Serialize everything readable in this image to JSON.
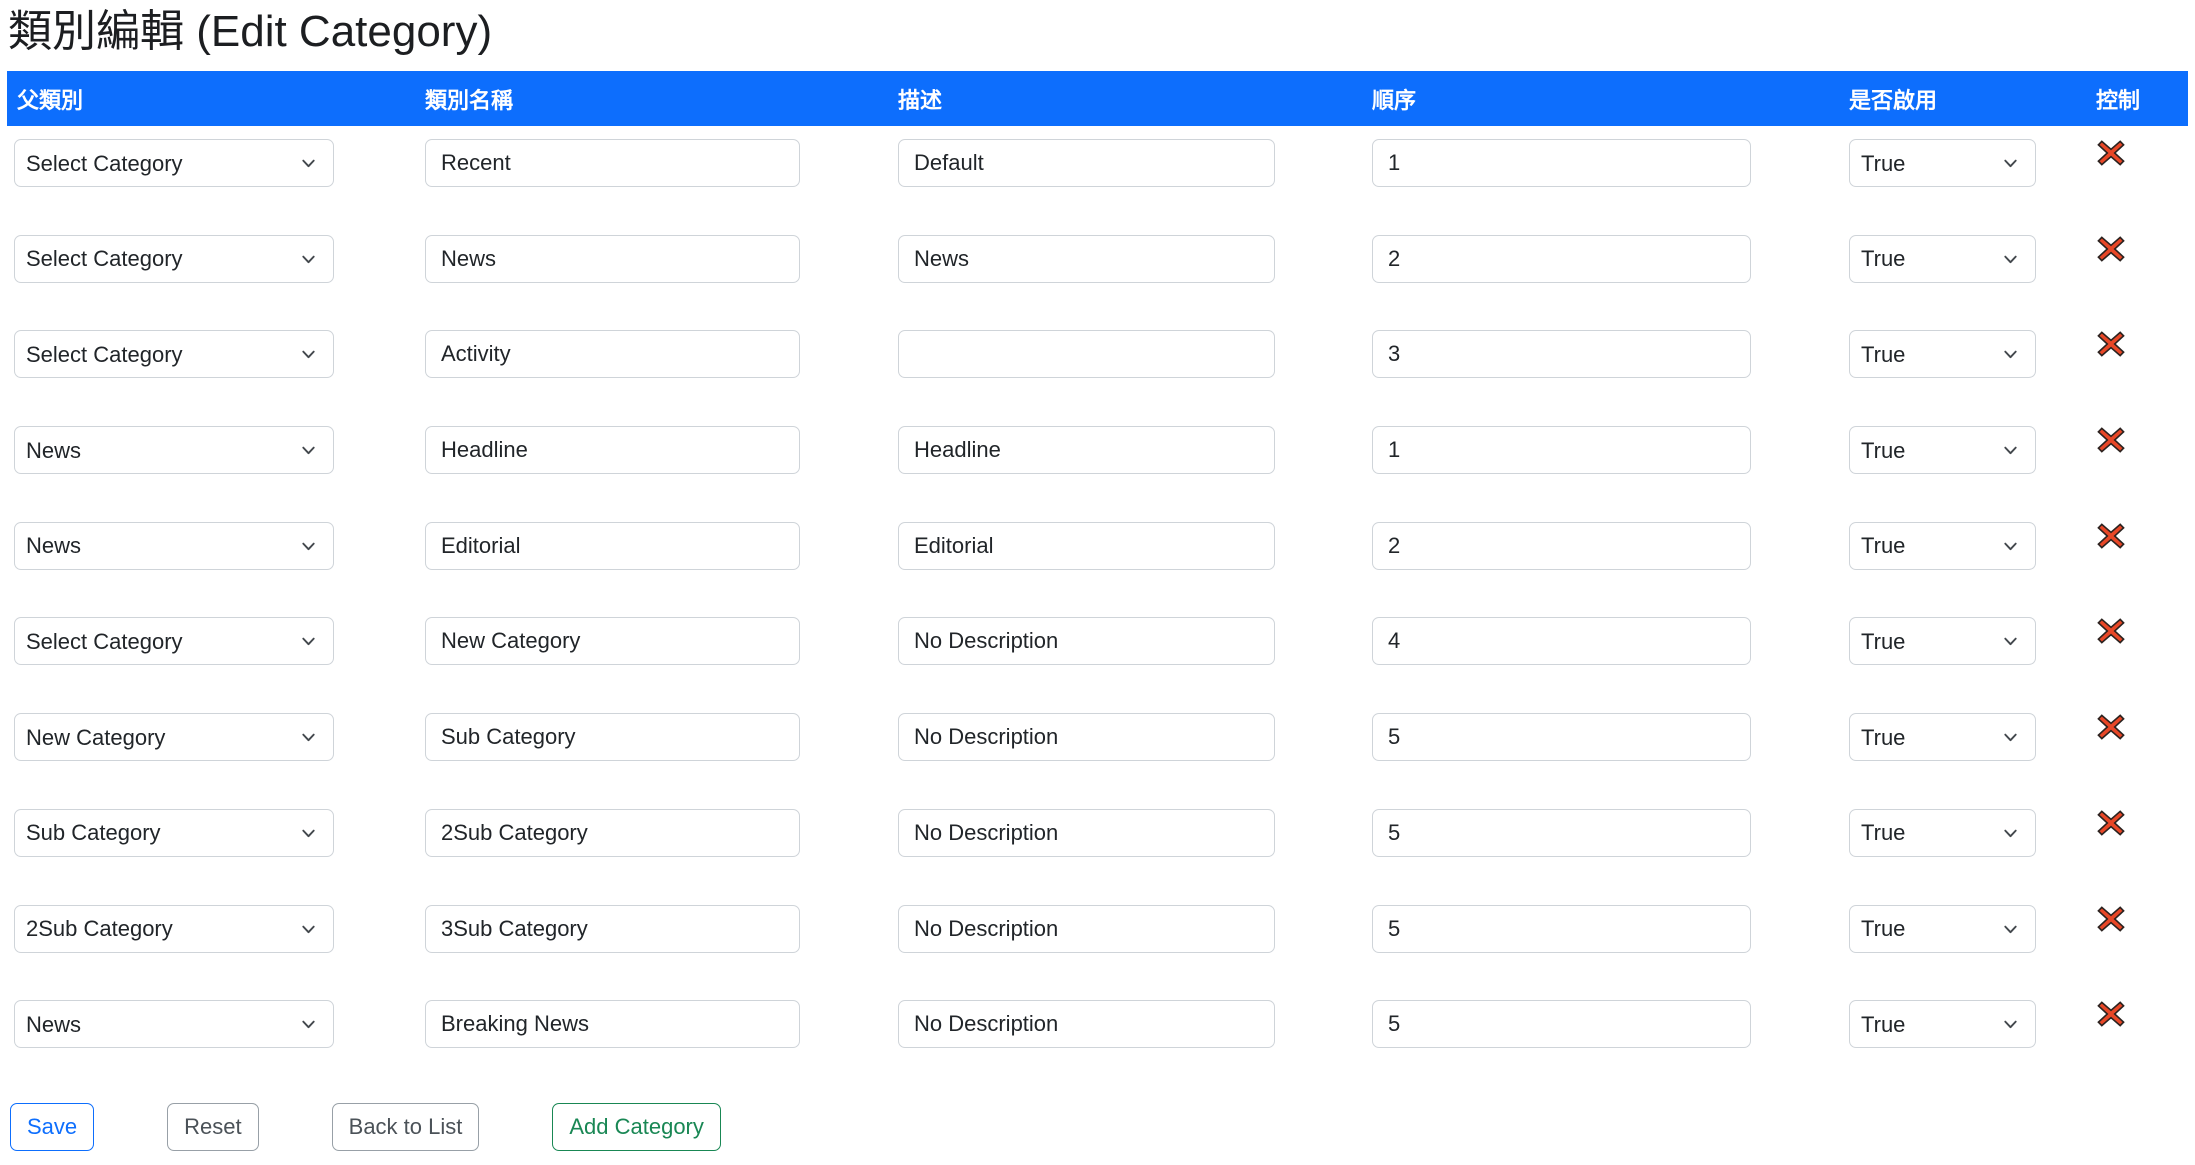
{
  "page": {
    "title": "類別編輯 (Edit Category)"
  },
  "colors": {
    "header_bg": "#0d6efd",
    "header_text": "#ffffff",
    "save_accent": "#0d6efd",
    "add_accent": "#198754",
    "delete_x": "#e84727"
  },
  "table": {
    "headers": [
      "父類別",
      "類別名稱",
      "描述",
      "順序",
      "是否啟用",
      "控制"
    ],
    "rows": [
      {
        "parent": "Select Category",
        "name": "Recent",
        "description": "Default",
        "order": "1",
        "enabled": "True"
      },
      {
        "parent": "Select Category",
        "name": "News",
        "description": "News",
        "order": "2",
        "enabled": "True"
      },
      {
        "parent": "Select Category",
        "name": "Activity",
        "description": "",
        "order": "3",
        "enabled": "True"
      },
      {
        "parent": "News",
        "name": "Headline",
        "description": "Headline",
        "order": "1",
        "enabled": "True"
      },
      {
        "parent": "News",
        "name": "Editorial",
        "description": "Editorial",
        "order": "2",
        "enabled": "True"
      },
      {
        "parent": "Select Category",
        "name": "New Category",
        "description": "No Description",
        "order": "4",
        "enabled": "True"
      },
      {
        "parent": "New Category",
        "name": "Sub Category",
        "description": "No Description",
        "order": "5",
        "enabled": "True"
      },
      {
        "parent": "Sub Category",
        "name": "2Sub Category",
        "description": "No Description",
        "order": "5",
        "enabled": "True"
      },
      {
        "parent": "2Sub Category",
        "name": "3Sub Category",
        "description": "No Description",
        "order": "5",
        "enabled": "True"
      },
      {
        "parent": "News",
        "name": "Breaking News",
        "description": "No Description",
        "order": "5",
        "enabled": "True"
      }
    ]
  },
  "actions": {
    "save": "Save",
    "reset": "Reset",
    "back_to_list": "Back to List",
    "add_category": "Add Category"
  }
}
